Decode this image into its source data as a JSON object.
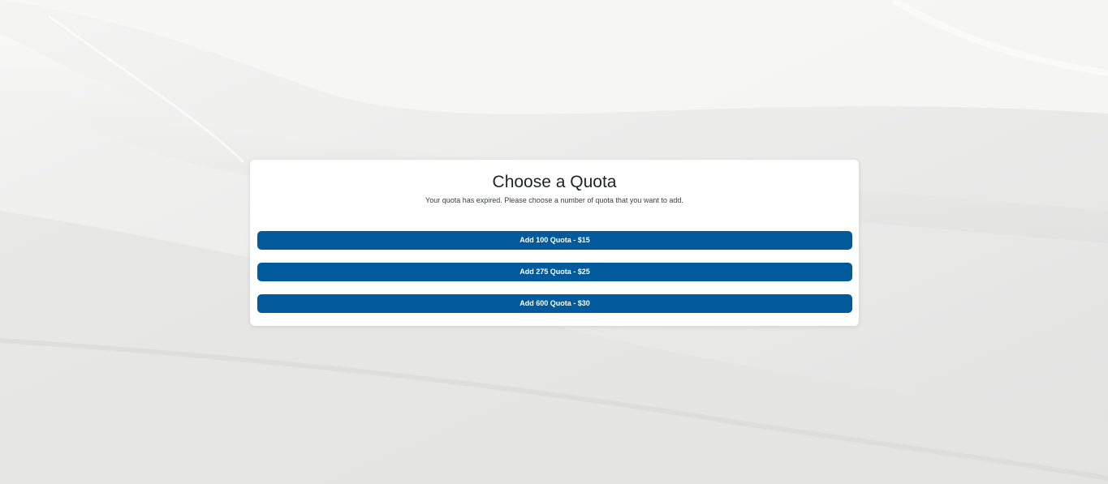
{
  "dialog": {
    "title": "Choose a Quota",
    "subtitle": "Your quota has expired. Please choose a number of quota that you want to add."
  },
  "options": [
    {
      "label": "Add 100 Quota - $15"
    },
    {
      "label": "Add 275 Quota - $25"
    },
    {
      "label": "Add 600 Quota - $30"
    }
  ],
  "colors": {
    "button_bg": "#005a9c",
    "button_text": "#ffffff",
    "card_bg": "#ffffff",
    "page_bg": "#ececeb"
  }
}
